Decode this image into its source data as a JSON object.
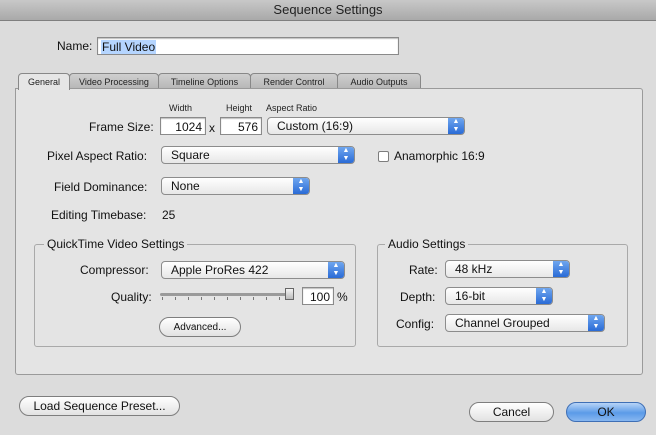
{
  "window": {
    "title": "Sequence Settings"
  },
  "name": {
    "label": "Name:",
    "value": "Full Video"
  },
  "tabs": [
    {
      "label": "General",
      "active": true
    },
    {
      "label": "Video Processing",
      "active": false
    },
    {
      "label": "Timeline Options",
      "active": false
    },
    {
      "label": "Render Control",
      "active": false
    },
    {
      "label": "Audio Outputs",
      "active": false
    }
  ],
  "general": {
    "width_header": "Width",
    "height_header": "Height",
    "aspect_header": "Aspect Ratio",
    "frame_size_label": "Frame Size:",
    "width_value": "1024",
    "times": "x",
    "height_value": "576",
    "aspect_value": "Custom (16:9)",
    "pixel_aspect_label": "Pixel Aspect Ratio:",
    "pixel_aspect_value": "Square",
    "anamorphic_label": "Anamorphic 16:9",
    "anamorphic_checked": false,
    "field_dominance_label": "Field Dominance:",
    "field_dominance_value": "None",
    "editing_timebase_label": "Editing Timebase:",
    "editing_timebase_value": "25"
  },
  "quicktime": {
    "title": "QuickTime Video Settings",
    "compressor_label": "Compressor:",
    "compressor_value": "Apple ProRes 422",
    "quality_label": "Quality:",
    "quality_value": "100",
    "quality_unit": "%",
    "quality_fraction": 1.0,
    "advanced_label": "Advanced..."
  },
  "audio": {
    "title": "Audio Settings",
    "rate_label": "Rate:",
    "rate_value": "48 kHz",
    "depth_label": "Depth:",
    "depth_value": "16-bit",
    "config_label": "Config:",
    "config_value": "Channel Grouped"
  },
  "footer": {
    "load_preset_label": "Load Sequence Preset...",
    "cancel_label": "Cancel",
    "ok_label": "OK"
  },
  "colors": {
    "accent": "#5b9be8",
    "selection": "#b5d5ff"
  }
}
